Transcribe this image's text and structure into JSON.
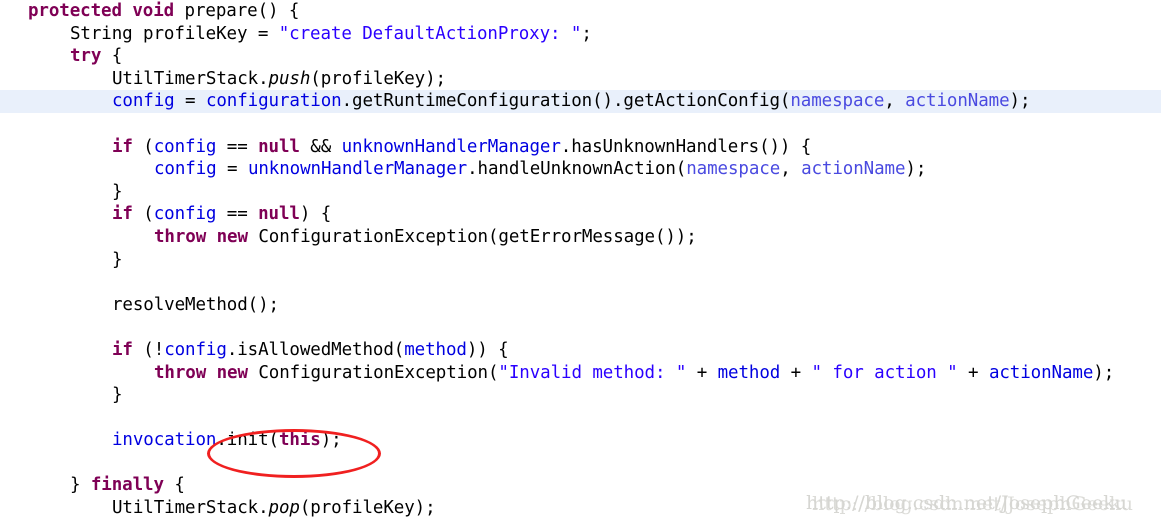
{
  "editor": {
    "language": "Java",
    "highlight_color": "#e9f0fb",
    "background_color": "#ffffff",
    "colors": {
      "keyword": "#7f0055",
      "string": "#2a00ff",
      "field": "#0000e0",
      "parameter": "#4a4ae0",
      "plain": "#000000"
    },
    "lines": [
      {
        "index": 0,
        "indent": 0,
        "highlighted": false,
        "text": "protected void prepare() {",
        "tokens": [
          {
            "t": "protected",
            "c": "kw"
          },
          {
            "t": " ",
            "c": "plain"
          },
          {
            "t": "void",
            "c": "kw"
          },
          {
            "t": " prepare() {",
            "c": "plain"
          }
        ]
      },
      {
        "index": 1,
        "indent": 1,
        "highlighted": false,
        "text": "String profileKey = \"create DefaultActionProxy: \";",
        "tokens": [
          {
            "t": "String profileKey = ",
            "c": "plain"
          },
          {
            "t": "\"create DefaultActionProxy: \"",
            "c": "str"
          },
          {
            "t": ";",
            "c": "plain"
          }
        ]
      },
      {
        "index": 2,
        "indent": 1,
        "highlighted": false,
        "text": "try {",
        "tokens": [
          {
            "t": "try",
            "c": "kw"
          },
          {
            "t": " {",
            "c": "plain"
          }
        ]
      },
      {
        "index": 3,
        "indent": 2,
        "highlighted": false,
        "text": "UtilTimerStack.push(profileKey);",
        "tokens": [
          {
            "t": "UtilTimerStack.",
            "c": "plain"
          },
          {
            "t": "push",
            "c": "static"
          },
          {
            "t": "(profileKey);",
            "c": "plain"
          }
        ]
      },
      {
        "index": 4,
        "indent": 2,
        "highlighted": true,
        "text": "config = configuration.getRuntimeConfiguration().getActionConfig(namespace, actionName);",
        "tokens": [
          {
            "t": "config",
            "c": "field"
          },
          {
            "t": " = ",
            "c": "plain"
          },
          {
            "t": "configuration",
            "c": "field"
          },
          {
            "t": ".getRuntimeConfiguration().getActionConfig(",
            "c": "plain"
          },
          {
            "t": "namespace",
            "c": "param"
          },
          {
            "t": ", ",
            "c": "plain"
          },
          {
            "t": "actionName",
            "c": "param"
          },
          {
            "t": ");",
            "c": "plain"
          }
        ]
      },
      {
        "index": 5,
        "indent": 0,
        "highlighted": false,
        "text": "",
        "tokens": []
      },
      {
        "index": 6,
        "indent": 2,
        "highlighted": false,
        "text": "if (config == null && unknownHandlerManager.hasUnknownHandlers()) {",
        "tokens": [
          {
            "t": "if",
            "c": "kw"
          },
          {
            "t": " (",
            "c": "plain"
          },
          {
            "t": "config",
            "c": "field"
          },
          {
            "t": " == ",
            "c": "plain"
          },
          {
            "t": "null",
            "c": "kw"
          },
          {
            "t": " && ",
            "c": "plain"
          },
          {
            "t": "unknownHandlerManager",
            "c": "field"
          },
          {
            "t": ".hasUnknownHandlers()) {",
            "c": "plain"
          }
        ]
      },
      {
        "index": 7,
        "indent": 3,
        "highlighted": false,
        "text": "config = unknownHandlerManager.handleUnknownAction(namespace, actionName);",
        "tokens": [
          {
            "t": "config",
            "c": "field"
          },
          {
            "t": " = ",
            "c": "plain"
          },
          {
            "t": "unknownHandlerManager",
            "c": "field"
          },
          {
            "t": ".handleUnknownAction(",
            "c": "plain"
          },
          {
            "t": "namespace",
            "c": "param"
          },
          {
            "t": ", ",
            "c": "plain"
          },
          {
            "t": "actionName",
            "c": "param"
          },
          {
            "t": ");",
            "c": "plain"
          }
        ]
      },
      {
        "index": 8,
        "indent": 2,
        "highlighted": false,
        "text": "}",
        "tokens": [
          {
            "t": "}",
            "c": "plain"
          }
        ]
      },
      {
        "index": 9,
        "indent": 2,
        "highlighted": false,
        "text": "if (config == null) {",
        "tokens": [
          {
            "t": "if",
            "c": "kw"
          },
          {
            "t": " (",
            "c": "plain"
          },
          {
            "t": "config",
            "c": "field"
          },
          {
            "t": " == ",
            "c": "plain"
          },
          {
            "t": "null",
            "c": "kw"
          },
          {
            "t": ") {",
            "c": "plain"
          }
        ]
      },
      {
        "index": 10,
        "indent": 3,
        "highlighted": false,
        "text": "throw new ConfigurationException(getErrorMessage());",
        "tokens": [
          {
            "t": "throw",
            "c": "kw"
          },
          {
            "t": " ",
            "c": "plain"
          },
          {
            "t": "new",
            "c": "kw"
          },
          {
            "t": " ConfigurationException(getErrorMessage());",
            "c": "plain"
          }
        ]
      },
      {
        "index": 11,
        "indent": 2,
        "highlighted": false,
        "text": "}",
        "tokens": [
          {
            "t": "}",
            "c": "plain"
          }
        ]
      },
      {
        "index": 12,
        "indent": 0,
        "highlighted": false,
        "text": "",
        "tokens": []
      },
      {
        "index": 13,
        "indent": 2,
        "highlighted": false,
        "text": "resolveMethod();",
        "tokens": [
          {
            "t": "resolveMethod();",
            "c": "plain"
          }
        ]
      },
      {
        "index": 14,
        "indent": 0,
        "highlighted": false,
        "text": "",
        "tokens": []
      },
      {
        "index": 15,
        "indent": 2,
        "highlighted": false,
        "text": "if (!config.isAllowedMethod(method)) {",
        "tokens": [
          {
            "t": "if",
            "c": "kw"
          },
          {
            "t": " (!",
            "c": "plain"
          },
          {
            "t": "config",
            "c": "field"
          },
          {
            "t": ".isAllowedMethod(",
            "c": "plain"
          },
          {
            "t": "method",
            "c": "field"
          },
          {
            "t": ")) {",
            "c": "plain"
          }
        ]
      },
      {
        "index": 16,
        "indent": 3,
        "highlighted": false,
        "text": "throw new ConfigurationException(\"Invalid method: \" + method + \" for action \" + actionName",
        "tokens": [
          {
            "t": "throw",
            "c": "kw"
          },
          {
            "t": " ",
            "c": "plain"
          },
          {
            "t": "new",
            "c": "kw"
          },
          {
            "t": " ConfigurationException(",
            "c": "plain"
          },
          {
            "t": "\"Invalid method: \"",
            "c": "str"
          },
          {
            "t": " + ",
            "c": "plain"
          },
          {
            "t": "method",
            "c": "field"
          },
          {
            "t": " + ",
            "c": "plain"
          },
          {
            "t": "\" for action \"",
            "c": "str"
          },
          {
            "t": " + ",
            "c": "plain"
          },
          {
            "t": "actionName",
            "c": "field"
          },
          {
            "t": ");",
            "c": "plain"
          }
        ]
      },
      {
        "index": 17,
        "indent": 2,
        "highlighted": false,
        "text": "}",
        "tokens": [
          {
            "t": "}",
            "c": "plain"
          }
        ]
      },
      {
        "index": 18,
        "indent": 0,
        "highlighted": false,
        "text": "",
        "tokens": []
      },
      {
        "index": 19,
        "indent": 2,
        "highlighted": false,
        "text": "invocation.init(this);",
        "tokens": [
          {
            "t": "invocation",
            "c": "field"
          },
          {
            "t": ".init(",
            "c": "plain"
          },
          {
            "t": "this",
            "c": "kw"
          },
          {
            "t": ");",
            "c": "plain"
          }
        ]
      },
      {
        "index": 20,
        "indent": 0,
        "highlighted": false,
        "text": "",
        "tokens": []
      },
      {
        "index": 21,
        "indent": 1,
        "highlighted": false,
        "text": "} finally {",
        "tokens": [
          {
            "t": "} ",
            "c": "plain"
          },
          {
            "t": "finally",
            "c": "kw"
          },
          {
            "t": " {",
            "c": "plain"
          }
        ]
      },
      {
        "index": 22,
        "indent": 2,
        "highlighted": false,
        "text": "UtilTimerStack.pop(profileKey);",
        "tokens": [
          {
            "t": "UtilTimerStack.",
            "c": "plain"
          },
          {
            "t": "pop",
            "c": "static"
          },
          {
            "t": "(profileKey);",
            "c": "plain"
          }
        ]
      }
    ]
  },
  "annotation": {
    "type": "ellipse",
    "color": "#f02020",
    "encircled_text": "n.init(this);"
  },
  "watermark": {
    "text": "http://blog.csdn.net/JosephGeeku",
    "color": "#d2d2ce"
  }
}
